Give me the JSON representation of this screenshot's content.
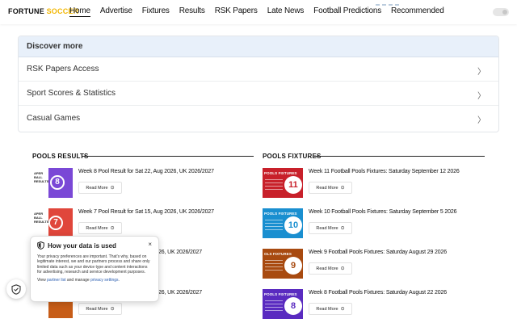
{
  "site": {
    "logo_part1": "FORTUNE",
    "logo_part2": "SOCCER"
  },
  "nav": [
    {
      "label": "Home",
      "active": true
    },
    {
      "label": "Advertise"
    },
    {
      "label": "Fixtures"
    },
    {
      "label": "Results"
    },
    {
      "label": "RSK Papers"
    },
    {
      "label": "Late News"
    },
    {
      "label": "Football Predictions"
    },
    {
      "label": "Recommended"
    }
  ],
  "discover": {
    "title": "Discover more",
    "items": [
      "RSK Papers Access",
      "Sport Scores & Statistics",
      "Casual Games"
    ]
  },
  "pools_results": {
    "title": "POOLS RESULTS",
    "read_more": "Read More",
    "items": [
      {
        "title": "Week 8 Pool Result for Sat 22, Aug 2026, UK 2026/2027",
        "num": "8",
        "thumb_text": "APER\nBALL\nRESULTS"
      },
      {
        "title": "Week 7 Pool Result for Sat 15, Aug 2026, UK 2026/2027",
        "num": "7",
        "thumb_text": "APER\nBALL\nRESULTS"
      },
      {
        "title": "26, UK 2026/2027"
      },
      {
        "title": "26, UK 2026/2027"
      }
    ]
  },
  "pools_fixtures": {
    "title": "POOLS FIXTURES",
    "read_more": "Read More",
    "items": [
      {
        "title": "Week 11 Football Pools Fixtures: Saturday September 12 2026",
        "num": "11",
        "banner": "POOLS FIXTURES"
      },
      {
        "title": "Week 10 Football Pools Fixtures: Saturday September 5 2026",
        "num": "10",
        "banner": "POOLS FIXTURES"
      },
      {
        "title": "Week 9 Football Pools Fixtures: Saturday August 29 2026",
        "num": "9",
        "banner": "OLS FIXTURES"
      },
      {
        "title": "Week 8 Football Pools Fixtures: Saturday August 22 2026",
        "num": "8",
        "banner": "POOLS FIXTURES"
      }
    ]
  },
  "privacy": {
    "title": "How your data is used",
    "close": "×",
    "body": "Your privacy preferences are important. That's why, based on legitimate interest, we and our partners process and share only limited data such as your device type and content interactions for advertising, research and service development purposes.",
    "links_prefix": "View",
    "partner_link": "partner list",
    "links_mid": "and manage",
    "settings_link": "privacy settings",
    "links_suffix": "."
  },
  "colors": {
    "accent_blue": "#e8f0fa",
    "logo_yellow": "#f2b705",
    "result_purple": "#7a48d6",
    "fixture_red": "#c8202a",
    "fixture_blue": "#1a8fd0",
    "fixture_brown": "#a84a10",
    "fixture_purple": "#5a2bc0"
  }
}
